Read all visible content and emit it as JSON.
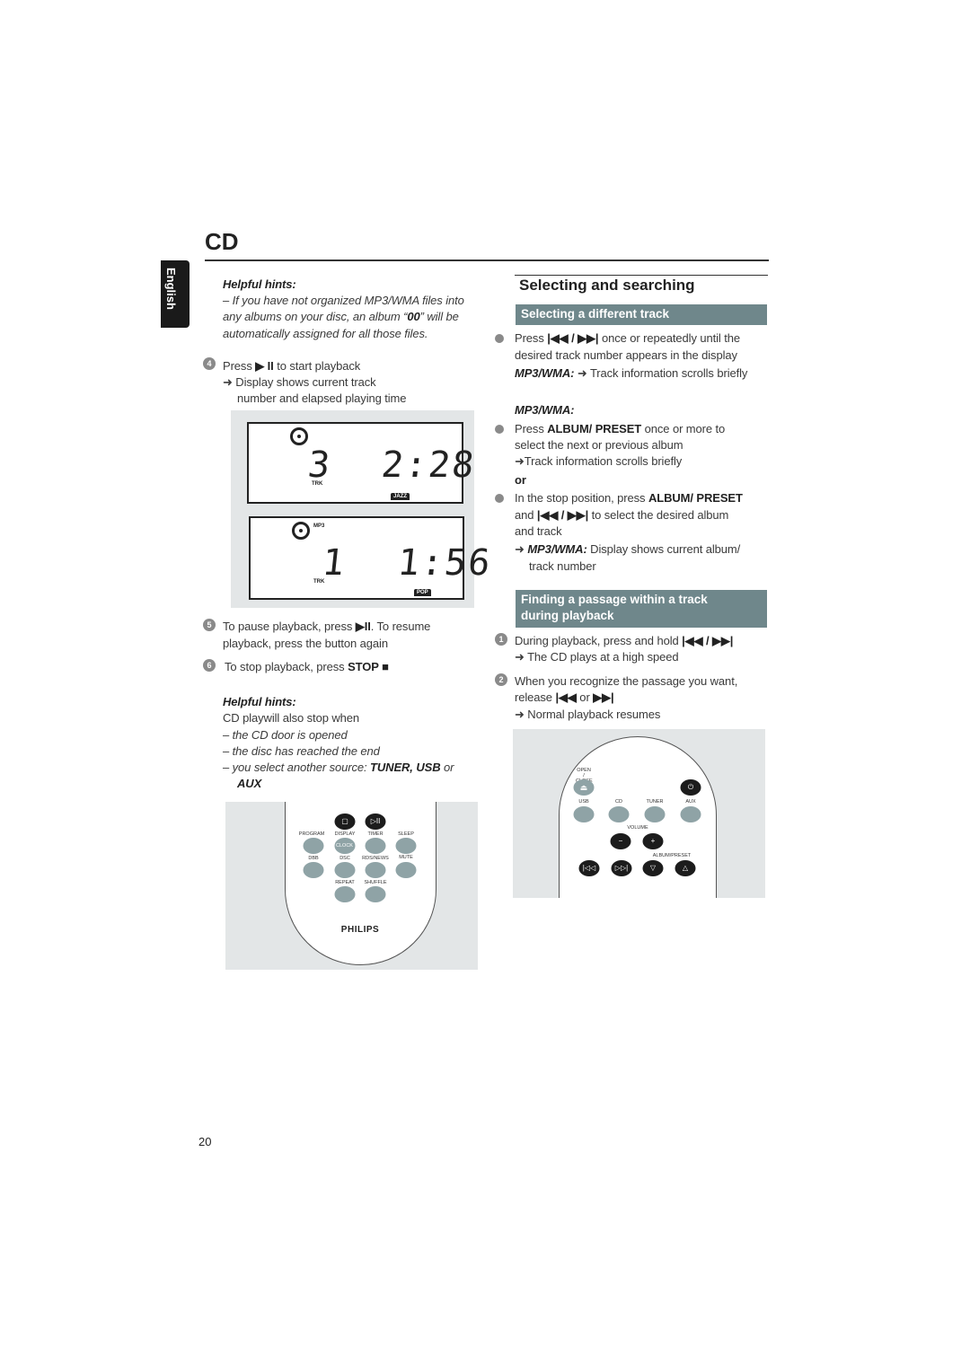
{
  "header": {
    "title": "CD",
    "language_tab": "English",
    "page_number": "20"
  },
  "left": {
    "hints1": {
      "title": "Helpful hints:",
      "l1": "–  If you have not organized MP3/WMA files into",
      "l2a": "any albums on your disc, an album “",
      "l2b": "00",
      "l2c": "” will be",
      "l3": "automatically assigned for all those files."
    },
    "step4": {
      "num": "4",
      "l1a": "Press ",
      "l1b": "▶ II",
      "l1c": " to start playback",
      "l2": "➜ Display shows current track",
      "l3": "number and elapsed playing time"
    },
    "display1": {
      "track": "3",
      "time": "2:28",
      "track_label": "TRK",
      "genre": "JAZZ"
    },
    "display2": {
      "format": "MP3",
      "track": "1",
      "time": "1:56",
      "track_label": "TRK",
      "genre": "POP"
    },
    "step5": {
      "num": "5",
      "l1a": "To pause playback, press ",
      "l1b": "▶II",
      "l1c": ".  To resume",
      "l2": "playback, press the button again"
    },
    "step6": {
      "num": "6",
      "l1a": "To stop playback, press ",
      "l1b": "STOP ■"
    },
    "hints2": {
      "title": "Helpful hints:",
      "intro": "CD playwill also stop when",
      "l1": "–  the CD door is opened",
      "l2": "–  the disc has reached the end",
      "l3a": "–  you select another source: ",
      "l3b": "TUNER, USB",
      "l3c": " or",
      "l4": "AUX"
    },
    "remote": {
      "labels": [
        "PROGRAM",
        "DISPLAY",
        "TIMER",
        "SLEEP",
        "DBB",
        "DSC",
        "RDS/NEWS",
        "MUTE",
        "REPEAT",
        "SHUFFLE"
      ],
      "clock": "CLOCK",
      "stop_icon": "▢",
      "play_pause_icon": "▷II",
      "brand": "PHILIPS"
    }
  },
  "right": {
    "section_title": "Selecting and searching",
    "sub1": {
      "title": "Selecting a different track",
      "p1a": "Press ",
      "p1b": "|◀◀  /  ▶▶|",
      "p1c": "  once or repeatedly until the",
      "p2": "desired track number appears in the display",
      "p3a": "MP3/WMA:",
      "p3b": " ➜ Track information scrolls briefly",
      "mp3_title": "MP3/WMA:",
      "q1a": "Press ",
      "q1b": "ALBUM/ PRESET",
      "q1c": " once or more to",
      "q2": "select the next or previous album",
      "q3": "➜Track information scrolls briefly",
      "or": "or",
      "r1a": "In the stop position, press ",
      "r1b": "ALBUM/ PRESET",
      "r2a": "and ",
      "r2b": "|◀◀  /  ▶▶|",
      "r2c": "  to  select the desired album",
      "r3": "and track",
      "r4a": "➜ ",
      "r4b": "MP3/WMA:",
      "r4c": "  Display shows current album/",
      "r5": "track number"
    },
    "sub2": {
      "title1": "Finding a passage within a track",
      "title2": "during playback",
      "s1num": "1",
      "s1a": "During playback, press and hold  ",
      "s1b": "|◀◀  /  ▶▶|",
      "s1c": "➜  The CD plays at a high speed",
      "s2num": "2",
      "s2a": "When you recognize the passage you want,",
      "s2b": "release ",
      "s2c": "|◀◀",
      "s2d": "  or  ",
      "s2e": "▶▶|",
      "s2f": "➜  Normal playback resumes"
    },
    "remote": {
      "open_close": "OPEN / CLOSE",
      "labels": [
        "USB",
        "CD",
        "TUNER",
        "AUX"
      ],
      "volume": "VOLUME",
      "album_preset": "ALBUM/PRESET",
      "power_icon": "⏻",
      "eject_icon": "⏏",
      "minus_icon": "−",
      "plus_icon": "+",
      "prev_icon": "|◁◁",
      "next_icon": "▷▷|",
      "down_icon": "▽",
      "up_icon": "△"
    }
  },
  "colors": {
    "accent_bar": "#6f878b",
    "button": "#8fa3a6",
    "figure_bg": "#e3e6e7"
  }
}
